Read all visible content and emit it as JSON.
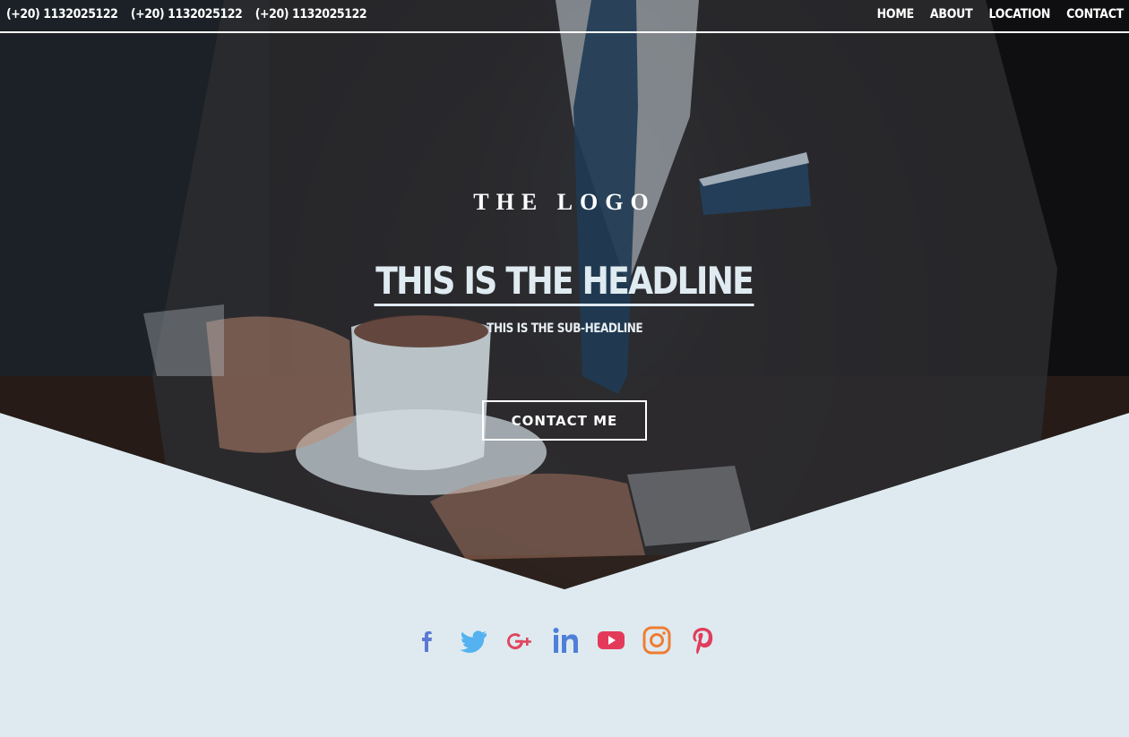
{
  "header": {
    "phones": [
      "(+20) 1132025122",
      "(+20) 1132025122",
      "(+20) 1132025122"
    ],
    "nav": [
      "HOME",
      "ABOUT",
      "LOCATION",
      "CONTACT"
    ]
  },
  "hero": {
    "logo": "THE LOGO",
    "headline": "THIS IS THE HEADLINE",
    "subheadline": "THIS IS THE SUB-HEADLINE",
    "cta_label": "CONTACT ME"
  },
  "social": [
    {
      "name": "facebook-icon",
      "color": "#5b7ad6"
    },
    {
      "name": "twitter-icon",
      "color": "#55b2f0"
    },
    {
      "name": "google-plus-icon",
      "color": "#e0465e"
    },
    {
      "name": "linkedin-icon",
      "color": "#4f80d8"
    },
    {
      "name": "youtube-icon",
      "color": "#e43a5a"
    },
    {
      "name": "instagram-icon",
      "color": "#ef7d33"
    },
    {
      "name": "pinterest-icon",
      "color": "#e03d5c"
    }
  ],
  "colors": {
    "page_background": "#deeaf0",
    "headline": "#dfeaf1",
    "hero_overlay": "#141516"
  }
}
